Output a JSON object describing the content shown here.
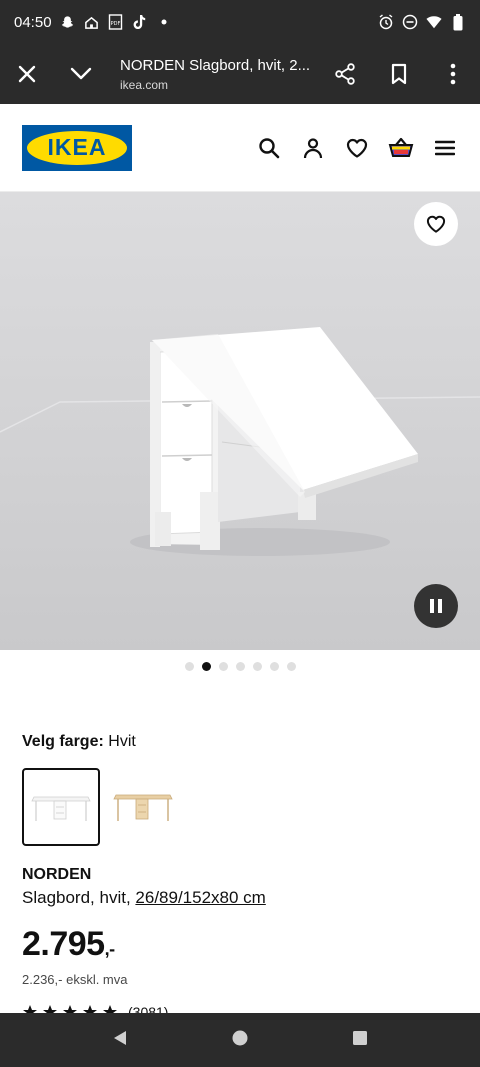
{
  "status_bar": {
    "time": "04:50",
    "left_icons": [
      "snapchat-icon",
      "home-icon",
      "pdf-icon",
      "tiktok-icon",
      "dot-icon"
    ],
    "right_icons": [
      "alarm-icon",
      "do-not-disturb-icon",
      "wifi-icon",
      "battery-icon"
    ]
  },
  "browser": {
    "title": "NORDEN Slagbord, hvit, 2...",
    "url": "ikea.com"
  },
  "site": {
    "logo_text": "IKEA",
    "brand_blue": "#0058a3",
    "brand_yellow": "#ffdb00"
  },
  "carousel": {
    "dot_count": 7,
    "active_index": 1
  },
  "product": {
    "color_label": "Velg farge:",
    "color_value": "Hvit",
    "name": "NORDEN",
    "desc_prefix": "Slagbord, hvit, ",
    "desc_size": "26/89/152x80 cm",
    "price_main": "2.795",
    "price_suffix": ",-",
    "price_ex_vat": "2.236,- ekskl. mva",
    "rating_count": "(3081)"
  }
}
